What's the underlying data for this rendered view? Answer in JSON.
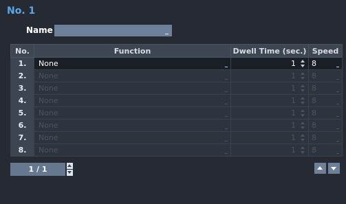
{
  "title": "No. 1",
  "name_field": {
    "label": "Name",
    "value": ""
  },
  "table": {
    "headers": {
      "no": "No.",
      "function": "Function",
      "dwell": "Dwell Time (sec.)",
      "speed": "Speed"
    },
    "rows": [
      {
        "no": "1.",
        "function": "None",
        "dwell": "1",
        "speed": "8",
        "enabled": true
      },
      {
        "no": "2.",
        "function": "None",
        "dwell": "1",
        "speed": "8",
        "enabled": false
      },
      {
        "no": "3.",
        "function": "None",
        "dwell": "1",
        "speed": "8",
        "enabled": false
      },
      {
        "no": "4.",
        "function": "None",
        "dwell": "1",
        "speed": "8",
        "enabled": false
      },
      {
        "no": "5.",
        "function": "None",
        "dwell": "1",
        "speed": "8",
        "enabled": false
      },
      {
        "no": "6.",
        "function": "None",
        "dwell": "1",
        "speed": "8",
        "enabled": false
      },
      {
        "no": "7.",
        "function": "None",
        "dwell": "1",
        "speed": "8",
        "enabled": false
      },
      {
        "no": "8.",
        "function": "None",
        "dwell": "1",
        "speed": "8",
        "enabled": false
      }
    ]
  },
  "pagination": {
    "page_text": "1 / 1"
  },
  "icons": {
    "page_up": "chevron-up-icon",
    "page_down": "chevron-down-icon",
    "move_up": "arrow-up-icon",
    "move_down": "arrow-down-icon"
  },
  "colors": {
    "accent": "#5aa8ea",
    "background": "#262b33",
    "input": "#6d7f99"
  }
}
